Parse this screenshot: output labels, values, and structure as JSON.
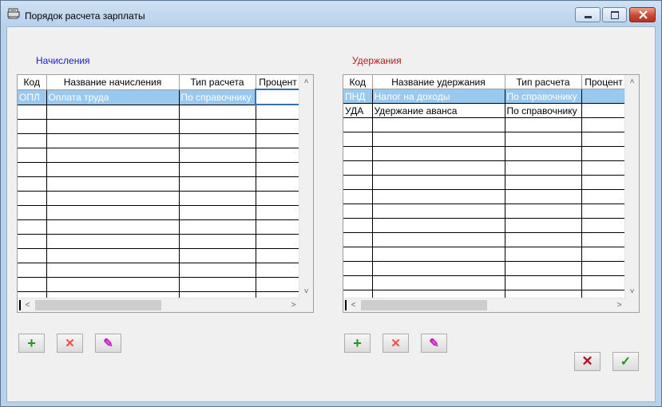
{
  "window": {
    "title": "Порядок расчета зарплаты"
  },
  "accruals": {
    "label": "Начисления",
    "label_color": "#1a1acc",
    "columns": [
      "Код",
      "Название начисления",
      "Тип расчета",
      "Процент"
    ],
    "rows": [
      {
        "code": "ОПЛ",
        "name": "Оплата труда",
        "type": "По справочнику",
        "percent": ""
      }
    ]
  },
  "deductions": {
    "label": "Удержания",
    "label_color": "#c01818",
    "columns": [
      "Код",
      "Название удержания",
      "Тип расчета",
      "Процент"
    ],
    "rows": [
      {
        "code": "ПНД",
        "name": "Налог на доходы",
        "type": "По справочнику",
        "percent": ""
      },
      {
        "code": "УДА",
        "name": "Удержание аванса",
        "type": "По справочнику",
        "percent": ""
      }
    ]
  },
  "icons": {
    "add": "plus-icon",
    "delete": "x-icon",
    "edit": "pencil-icon",
    "cancel": "x-icon",
    "ok": "check-icon",
    "glyph_add": "+",
    "glyph_delete": "✕",
    "glyph_edit": "✎",
    "glyph_ok": "✓",
    "glyph_up": "˄",
    "glyph_down": "˅",
    "glyph_left": "<",
    "glyph_right": ">"
  }
}
